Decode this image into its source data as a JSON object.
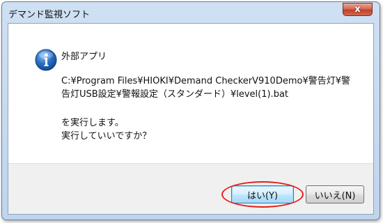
{
  "window": {
    "title": "デマンド監視ソフト",
    "close_label": "x"
  },
  "dialog": {
    "icon": "info-icon",
    "heading": "外部アプリ",
    "path_line1": "C:¥Program Files¥HIOKI¥Demand CheckerV910Demo¥警告灯¥警",
    "path_line2": "告灯USB設定¥警報設定（スタンダード）¥level(1).bat",
    "message_line1": "を実行します。",
    "message_line2": "実行していいですか？"
  },
  "buttons": {
    "yes_label": "はい(Y)",
    "no_label": "いいえ(N)"
  },
  "colors": {
    "accent": "#2e6fc0",
    "highlight": "#e21f1f",
    "close": "#c2402a"
  }
}
